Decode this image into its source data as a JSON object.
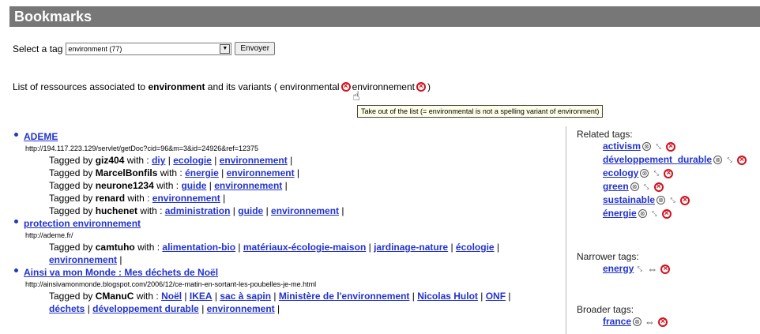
{
  "header": {
    "title": "Bookmarks"
  },
  "selector": {
    "label": "Select a tag",
    "value": "environment (77)",
    "submit_label": "Envoyer"
  },
  "list_intro": {
    "prefix": "List of ressources associated to",
    "tag": "environment",
    "middle": "and its variants (",
    "variant1": "environmental",
    "variant2": "environnement",
    "suffix": ")"
  },
  "tooltip": "Take out of the list (= environmental is not a spelling variant of environment)",
  "bookmarks": [
    {
      "title": "ADEME",
      "url": "http://194.117.223.129/servlet/getDoc?cid=96&m=3&id=24926&ref=12375",
      "taggings": [
        {
          "prefix": "Tagged by",
          "user": "giz404",
          "with": "with :",
          "tags": [
            "diy",
            "ecologie",
            "environnement"
          ]
        },
        {
          "prefix": "Tagged by",
          "user": "MarcelBonfils",
          "with": "with :",
          "tags": [
            "énergie",
            "environnement"
          ]
        },
        {
          "prefix": "Tagged by",
          "user": "neurone1234",
          "with": "with :",
          "tags": [
            "guide",
            "environnement"
          ]
        },
        {
          "prefix": "Tagged by",
          "user": "renard",
          "with": "with :",
          "tags": [
            "environnement"
          ]
        },
        {
          "prefix": "Tagged by",
          "user": "huchenet",
          "with": "with :",
          "tags": [
            "administration",
            "guide",
            "environnement"
          ]
        }
      ]
    },
    {
      "title": "protection environnement",
      "url": "http://ademe.fr/",
      "taggings": [
        {
          "prefix": "Tagged by",
          "user": "camtuho",
          "with": "with :",
          "tags": [
            "alimentation-bio",
            "matériaux-écologie-maison",
            "jardinage-nature",
            "écologie",
            "environnement"
          ]
        }
      ]
    },
    {
      "title": "Ainsi va mon Monde : Mes déchets de Noël",
      "url": "http://ainsivamonmonde.blogspot.com/2006/12/ce-matin-en-sortant-les-poubelles-je-me.html",
      "taggings": [
        {
          "prefix": "Tagged by",
          "user": "CManuC",
          "with": "with :",
          "tags": [
            "Noël",
            "IKEA",
            "sac à sapin",
            "Ministère de l'environnement",
            "Nicolas Hulot",
            "ONF",
            "déchets",
            "développement durable",
            "environnement"
          ]
        }
      ]
    }
  ],
  "sidebar": {
    "related": {
      "heading": "Related tags:",
      "tags": [
        "activism",
        "développement_durable",
        "ecology",
        "green",
        "sustainable",
        "énergie"
      ]
    },
    "narrower": {
      "heading": "Narrower tags:",
      "tags": [
        "energy"
      ]
    },
    "broader": {
      "heading": "Broader tags:",
      "tags": [
        "france"
      ]
    }
  }
}
